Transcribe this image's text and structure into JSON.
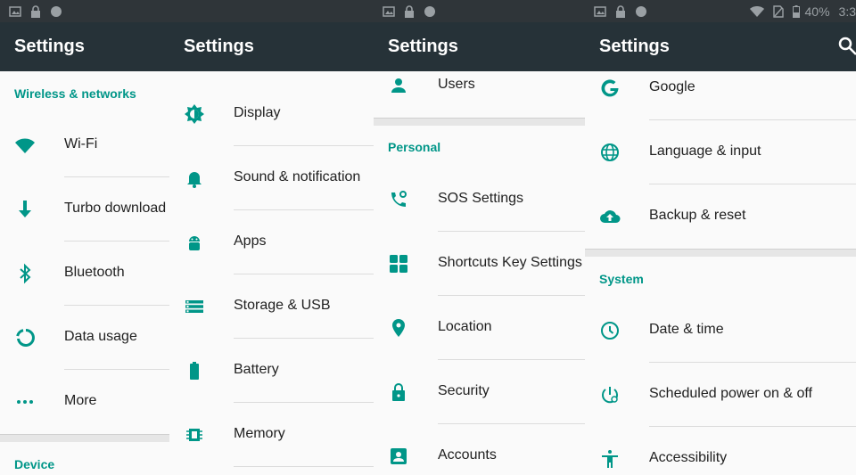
{
  "status": {
    "battery_text": "40%",
    "time_text": "3:3"
  },
  "colors": {
    "accent": "#009688",
    "appbar": "#263238",
    "statusbar": "#2f3539",
    "text": "#212121",
    "background": "#fafafa"
  },
  "panels": [
    {
      "title": "Settings",
      "header1": "Wireless & networks",
      "footer_header": "Device",
      "items": [
        {
          "label": "Wi-Fi",
          "icon": "wifi-icon"
        },
        {
          "label": "Turbo download",
          "icon": "download-arrow-icon"
        },
        {
          "label": "Bluetooth",
          "icon": "bluetooth-icon"
        },
        {
          "label": "Data usage",
          "icon": "data-usage-icon"
        },
        {
          "label": "More",
          "icon": "more-dots-icon"
        }
      ]
    },
    {
      "title": "Settings",
      "items": [
        {
          "label": "Display",
          "icon": "brightness-icon"
        },
        {
          "label": "Sound & notification",
          "icon": "bell-icon"
        },
        {
          "label": "Apps",
          "icon": "android-icon"
        },
        {
          "label": "Storage & USB",
          "icon": "storage-icon"
        },
        {
          "label": "Battery",
          "icon": "battery-icon"
        },
        {
          "label": "Memory",
          "icon": "memory-chip-icon"
        }
      ]
    },
    {
      "title": "Settings",
      "top_item": {
        "label": "Users",
        "icon": "person-icon"
      },
      "header": "Personal",
      "items": [
        {
          "label": "SOS Settings",
          "icon": "sos-phone-icon"
        },
        {
          "label": "Shortcuts Key Settings",
          "icon": "grid-icon"
        },
        {
          "label": "Location",
          "icon": "location-pin-icon"
        },
        {
          "label": "Security",
          "icon": "lock-icon"
        },
        {
          "label": "Accounts",
          "icon": "account-box-icon"
        }
      ]
    },
    {
      "title": "Settings",
      "top_items": [
        {
          "label": "Google",
          "icon": "google-icon"
        },
        {
          "label": "Language & input",
          "icon": "globe-icon"
        },
        {
          "label": "Backup & reset",
          "icon": "cloud-upload-icon"
        }
      ],
      "header": "System",
      "items": [
        {
          "label": "Date & time",
          "icon": "clock-icon"
        },
        {
          "label": "Scheduled power on & off",
          "icon": "scheduled-power-icon"
        },
        {
          "label": "Accessibility",
          "icon": "accessibility-icon"
        }
      ]
    }
  ]
}
